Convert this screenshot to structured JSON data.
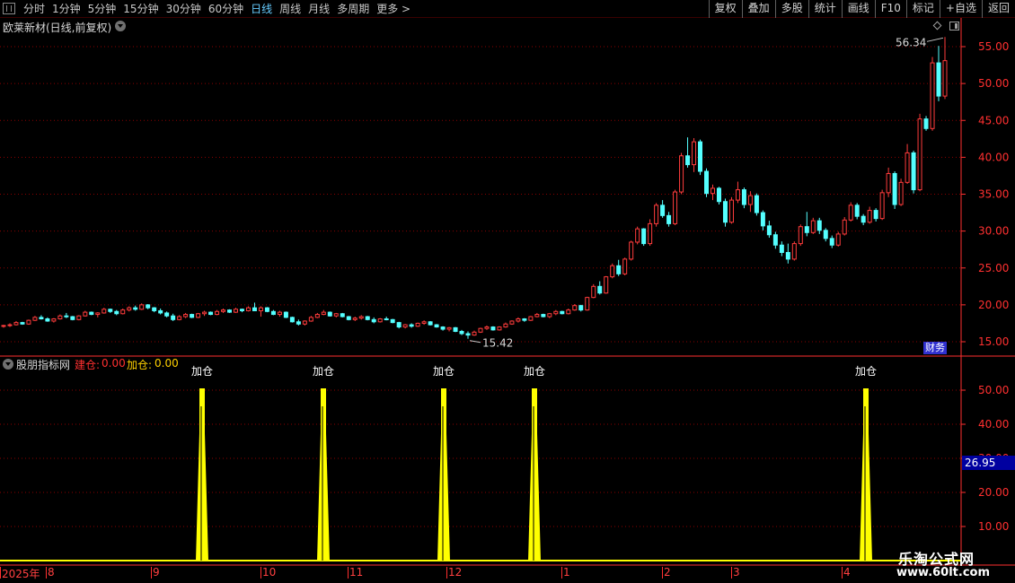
{
  "toolbar": {
    "periods": [
      {
        "label": "分时",
        "active": false
      },
      {
        "label": "1分钟",
        "active": false
      },
      {
        "label": "5分钟",
        "active": false
      },
      {
        "label": "15分钟",
        "active": false
      },
      {
        "label": "30分钟",
        "active": false
      },
      {
        "label": "60分钟",
        "active": false
      },
      {
        "label": "日线",
        "active": true
      },
      {
        "label": "周线",
        "active": false
      },
      {
        "label": "月线",
        "active": false
      },
      {
        "label": "多周期",
        "active": false
      },
      {
        "label": "更多 >",
        "active": false
      }
    ],
    "right_buttons": [
      "复权",
      "叠加",
      "多股",
      "统计",
      "画线",
      "F10",
      "标记",
      "+自选",
      "返回"
    ]
  },
  "stock": {
    "title": "欧莱新材(日线,前复权)"
  },
  "price_axis": {
    "ticks": [
      "55.00",
      "50.00",
      "45.00",
      "40.00",
      "35.00",
      "30.00",
      "25.00",
      "20.00",
      "15.00"
    ]
  },
  "annotations": {
    "high": "56.34",
    "low": "15.42"
  },
  "finance_tag": "财务",
  "indicator": {
    "name": "股朋指标网",
    "jc_label": "建仓:",
    "jc_value": "0.00",
    "jia_label": "加仓:",
    "jia_value": "0.00",
    "axis_ticks": [
      "50.00",
      "40.00",
      "30.00",
      "20.00",
      "10.00"
    ],
    "current_value": "26.95",
    "signal_label": "加仓"
  },
  "time_axis": {
    "labels": [
      "2025年",
      "8",
      "9",
      "10",
      "11",
      "12",
      "1",
      "2",
      "3",
      "4"
    ]
  },
  "watermark": {
    "name": "乐淘公式网",
    "url": "www.60lt.com"
  },
  "colors": {
    "up": "#ff3c3c",
    "down": "#54ffff",
    "signal": "#ffff00",
    "grid": "#8b0000",
    "axis": "#ff3030"
  },
  "chart_data": {
    "type": "candlestick",
    "ylim": [
      15,
      57
    ],
    "candles": [
      [
        17.1,
        17.3,
        16.9,
        17.2
      ],
      [
        17.2,
        17.5,
        17.0,
        17.3
      ],
      [
        17.3,
        17.8,
        17.2,
        17.6
      ],
      [
        17.6,
        17.7,
        17.3,
        17.4
      ],
      [
        17.4,
        18.0,
        17.3,
        17.9
      ],
      [
        17.9,
        18.5,
        17.8,
        18.3
      ],
      [
        18.3,
        18.6,
        18.0,
        18.1
      ],
      [
        18.1,
        18.3,
        17.7,
        17.8
      ],
      [
        17.8,
        18.2,
        17.6,
        18.1
      ],
      [
        18.1,
        18.7,
        18.0,
        18.5
      ],
      [
        18.5,
        18.9,
        18.2,
        18.4
      ],
      [
        18.4,
        18.5,
        17.9,
        18.0
      ],
      [
        18.0,
        18.6,
        17.9,
        18.5
      ],
      [
        18.5,
        19.2,
        18.4,
        19.0
      ],
      [
        19.0,
        19.1,
        18.6,
        18.7
      ],
      [
        18.7,
        19.0,
        18.3,
        18.9
      ],
      [
        18.9,
        19.6,
        18.8,
        19.4
      ],
      [
        19.4,
        19.5,
        18.9,
        19.1
      ],
      [
        19.1,
        19.3,
        18.6,
        18.8
      ],
      [
        18.8,
        19.5,
        18.7,
        19.3
      ],
      [
        19.3,
        19.8,
        19.1,
        19.6
      ],
      [
        19.6,
        19.9,
        19.2,
        19.4
      ],
      [
        19.4,
        20.2,
        19.3,
        20.0
      ],
      [
        20.0,
        20.1,
        19.4,
        19.6
      ],
      [
        19.6,
        19.7,
        19.0,
        19.2
      ],
      [
        19.2,
        19.5,
        18.7,
        18.9
      ],
      [
        18.9,
        19.1,
        18.3,
        18.5
      ],
      [
        18.5,
        18.8,
        17.8,
        18.0
      ],
      [
        18.0,
        18.6,
        17.9,
        18.4
      ],
      [
        18.4,
        18.9,
        18.2,
        18.7
      ],
      [
        18.7,
        18.8,
        18.2,
        18.3
      ],
      [
        18.3,
        18.9,
        18.2,
        18.8
      ],
      [
        18.8,
        19.2,
        18.5,
        19.0
      ],
      [
        19.0,
        19.1,
        18.6,
        18.7
      ],
      [
        18.7,
        19.3,
        18.6,
        19.1
      ],
      [
        19.1,
        19.5,
        18.9,
        19.3
      ],
      [
        19.3,
        19.4,
        18.9,
        19.0
      ],
      [
        19.0,
        19.6,
        18.9,
        19.4
      ],
      [
        19.4,
        19.5,
        19.0,
        19.2
      ],
      [
        19.2,
        19.8,
        19.1,
        19.6
      ],
      [
        19.6,
        20.3,
        19.5,
        19.2
      ],
      [
        19.2,
        19.8,
        18.4,
        19.6
      ],
      [
        19.6,
        19.7,
        19.0,
        19.1
      ],
      [
        19.1,
        19.3,
        18.6,
        18.7
      ],
      [
        18.7,
        19.2,
        18.4,
        19.0
      ],
      [
        19.0,
        19.1,
        18.2,
        18.3
      ],
      [
        18.3,
        18.4,
        17.6,
        17.7
      ],
      [
        17.7,
        18.0,
        17.2,
        17.4
      ],
      [
        17.4,
        17.9,
        17.2,
        17.8
      ],
      [
        17.8,
        18.5,
        17.7,
        18.3
      ],
      [
        18.3,
        18.9,
        18.2,
        18.7
      ],
      [
        18.7,
        19.3,
        18.6,
        19.0
      ],
      [
        19.0,
        19.1,
        18.4,
        18.5
      ],
      [
        18.5,
        18.9,
        18.3,
        18.8
      ],
      [
        18.8,
        18.9,
        18.3,
        18.4
      ],
      [
        18.4,
        18.5,
        17.9,
        18.0
      ],
      [
        18.0,
        18.4,
        17.8,
        18.2
      ],
      [
        18.2,
        18.6,
        18.0,
        18.4
      ],
      [
        18.4,
        18.5,
        17.9,
        18.0
      ],
      [
        18.0,
        18.3,
        17.5,
        17.7
      ],
      [
        17.7,
        18.2,
        17.6,
        18.1
      ],
      [
        18.1,
        18.4,
        17.9,
        18.0
      ],
      [
        18.0,
        18.1,
        17.5,
        17.6
      ],
      [
        17.6,
        17.7,
        16.8,
        17.0
      ],
      [
        17.0,
        17.4,
        16.8,
        17.3
      ],
      [
        17.3,
        17.5,
        16.9,
        17.1
      ],
      [
        17.1,
        17.6,
        17.0,
        17.5
      ],
      [
        17.5,
        17.9,
        17.3,
        17.7
      ],
      [
        17.7,
        17.8,
        17.2,
        17.3
      ],
      [
        17.3,
        17.4,
        16.9,
        17.0
      ],
      [
        17.0,
        17.1,
        16.5,
        16.7
      ],
      [
        16.7,
        17.0,
        16.4,
        16.9
      ],
      [
        16.9,
        17.0,
        16.3,
        16.4
      ],
      [
        16.4,
        16.6,
        15.9,
        16.1
      ],
      [
        16.1,
        16.4,
        15.4,
        15.9
      ],
      [
        15.9,
        16.5,
        15.8,
        16.3
      ],
      [
        16.3,
        16.9,
        16.2,
        16.8
      ],
      [
        16.8,
        17.2,
        16.6,
        17.0
      ],
      [
        17.0,
        17.1,
        16.5,
        16.6
      ],
      [
        16.6,
        17.1,
        16.5,
        17.0
      ],
      [
        17.0,
        17.6,
        16.9,
        17.4
      ],
      [
        17.4,
        17.9,
        17.3,
        17.8
      ],
      [
        17.8,
        18.3,
        17.6,
        18.1
      ],
      [
        18.1,
        18.2,
        17.7,
        17.9
      ],
      [
        17.9,
        18.5,
        17.8,
        18.4
      ],
      [
        18.4,
        18.9,
        18.3,
        18.7
      ],
      [
        18.7,
        18.8,
        18.3,
        18.4
      ],
      [
        18.4,
        18.9,
        18.2,
        18.8
      ],
      [
        18.8,
        19.3,
        18.6,
        19.1
      ],
      [
        19.1,
        19.2,
        18.7,
        18.8
      ],
      [
        18.8,
        19.5,
        18.7,
        19.3
      ],
      [
        19.3,
        20.1,
        19.2,
        19.9
      ],
      [
        19.9,
        20.0,
        19.1,
        19.3
      ],
      [
        19.3,
        21.1,
        19.2,
        21.0
      ],
      [
        21.0,
        22.8,
        20.9,
        22.5
      ],
      [
        22.5,
        23.2,
        21.4,
        21.6
      ],
      [
        21.6,
        23.9,
        21.5,
        23.8
      ],
      [
        23.8,
        25.6,
        23.6,
        25.3
      ],
      [
        25.3,
        26.1,
        23.9,
        24.2
      ],
      [
        24.2,
        26.4,
        24.0,
        26.2
      ],
      [
        26.2,
        28.7,
        26.0,
        28.5
      ],
      [
        28.5,
        30.6,
        28.2,
        30.3
      ],
      [
        30.3,
        30.4,
        28.0,
        28.3
      ],
      [
        28.3,
        31.6,
        28.0,
        31.0
      ],
      [
        31.0,
        33.8,
        30.6,
        33.5
      ],
      [
        33.5,
        34.2,
        31.8,
        32.1
      ],
      [
        32.1,
        32.6,
        30.6,
        31.0
      ],
      [
        31.0,
        35.6,
        30.8,
        35.3
      ],
      [
        35.3,
        40.6,
        35.0,
        40.2
      ],
      [
        40.2,
        42.7,
        38.6,
        39.0
      ],
      [
        39.0,
        42.6,
        38.0,
        42.1
      ],
      [
        42.1,
        42.4,
        37.6,
        38.1
      ],
      [
        38.1,
        38.5,
        34.6,
        35.1
      ],
      [
        35.1,
        36.3,
        34.2,
        35.8
      ],
      [
        35.8,
        36.0,
        33.6,
        34.0
      ],
      [
        34.0,
        34.4,
        30.6,
        31.2
      ],
      [
        31.2,
        34.6,
        31.0,
        34.2
      ],
      [
        34.2,
        36.7,
        33.8,
        35.6
      ],
      [
        35.6,
        35.9,
        33.1,
        33.6
      ],
      [
        33.6,
        35.4,
        32.6,
        34.8
      ],
      [
        34.8,
        35.1,
        32.1,
        32.5
      ],
      [
        32.5,
        32.8,
        30.1,
        30.7
      ],
      [
        30.7,
        31.4,
        29.1,
        29.5
      ],
      [
        29.5,
        29.9,
        27.6,
        28.1
      ],
      [
        28.1,
        28.6,
        26.6,
        27.1
      ],
      [
        27.1,
        28.3,
        25.6,
        26.2
      ],
      [
        26.2,
        28.6,
        26.0,
        28.3
      ],
      [
        28.3,
        30.9,
        28.0,
        30.6
      ],
      [
        30.6,
        32.6,
        29.3,
        29.8
      ],
      [
        29.8,
        31.8,
        29.6,
        31.4
      ],
      [
        31.4,
        31.8,
        29.6,
        30.1
      ],
      [
        30.1,
        30.4,
        28.6,
        29.0
      ],
      [
        29.0,
        29.4,
        27.7,
        28.1
      ],
      [
        28.1,
        29.9,
        27.9,
        29.6
      ],
      [
        29.6,
        31.9,
        29.4,
        31.5
      ],
      [
        31.5,
        33.9,
        31.3,
        33.5
      ],
      [
        33.5,
        33.8,
        31.6,
        32.0
      ],
      [
        32.0,
        32.3,
        30.8,
        31.2
      ],
      [
        31.2,
        33.3,
        31.0,
        32.8
      ],
      [
        32.8,
        33.1,
        31.3,
        31.7
      ],
      [
        31.7,
        35.6,
        31.5,
        35.2
      ],
      [
        35.2,
        38.6,
        34.6,
        37.8
      ],
      [
        37.8,
        38.1,
        33.0,
        33.6
      ],
      [
        33.6,
        37.1,
        33.4,
        36.6
      ],
      [
        36.6,
        41.8,
        36.4,
        40.6
      ],
      [
        40.6,
        40.9,
        35.1,
        35.6
      ],
      [
        35.6,
        45.9,
        35.4,
        45.2
      ],
      [
        45.2,
        45.6,
        43.6,
        43.9
      ],
      [
        43.9,
        53.6,
        43.6,
        52.8
      ],
      [
        52.8,
        55.1,
        47.6,
        48.3
      ],
      [
        48.3,
        56.3,
        47.9,
        53.1
      ]
    ],
    "signals": [
      225,
      360,
      494,
      595,
      964
    ]
  }
}
